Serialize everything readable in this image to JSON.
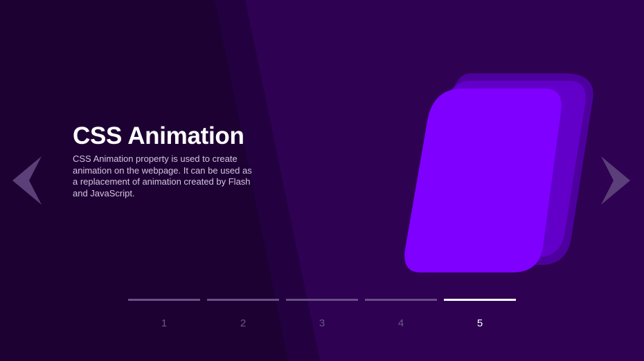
{
  "theme": {
    "background": "#2e0152",
    "dark_panel": "#1d0133",
    "card_primary": "#7f00ff",
    "card_mid": "#6200c9",
    "card_back": "#4e009e",
    "arrow_color": "#5b3f78",
    "pager_inactive": "#6b4f86",
    "pager_active": "#ffffff"
  },
  "slide": {
    "title": "CSS Animation",
    "description": "CSS Animation property is used to create animation on the webpage. It can be used as a replacement of animation created by Flash and JavaScript."
  },
  "navigation": {
    "prev_icon": "chevron-left-icon",
    "next_icon": "chevron-right-icon"
  },
  "pagination": {
    "active_index": 4,
    "items": [
      {
        "label": "1"
      },
      {
        "label": "2"
      },
      {
        "label": "3"
      },
      {
        "label": "4"
      },
      {
        "label": "5"
      }
    ]
  }
}
